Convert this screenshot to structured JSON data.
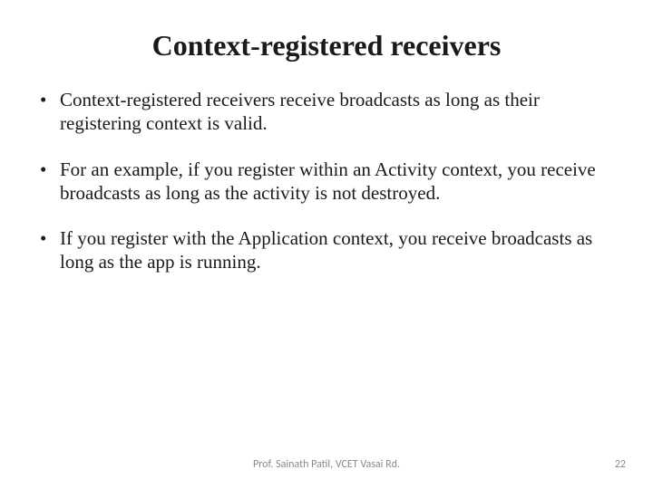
{
  "title": "Context-registered receivers",
  "bullets": [
    "Context-registered receivers receive broadcasts as long as their registering context is valid.",
    "For an example, if you register within an Activity context, you receive broadcasts as long as the activity is not destroyed.",
    "If you register with the Application context, you receive broadcasts as long as the app is running."
  ],
  "footer": {
    "author": "Prof. Sainath Patil, VCET Vasai Rd.",
    "page": "22"
  }
}
